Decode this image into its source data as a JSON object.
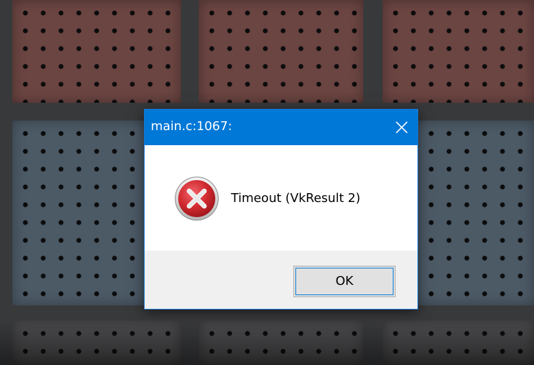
{
  "dialog": {
    "title": "main.c:1067:",
    "message": "Timeout (VkResult 2)",
    "icon": "error-icon",
    "ok_label": "OK",
    "close_icon": "close-icon"
  },
  "colors": {
    "titlebar": "#0078d7",
    "dialog_body": "#ffffff",
    "dialog_footer": "#f0f0f0",
    "button_face": "#e1e1e1",
    "button_focus": "#0078d7",
    "error_red": "#c8262b"
  }
}
